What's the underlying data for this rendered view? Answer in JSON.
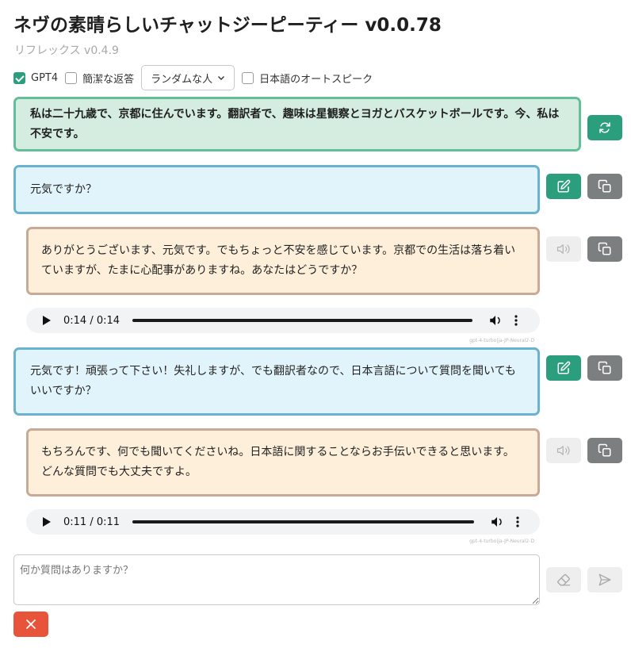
{
  "app": {
    "title": "ネヴの素晴らしいチャットジーピーティー v0.0.78",
    "subtitle": "リフレックス v0.4.9"
  },
  "options": {
    "gpt4": {
      "label": "GPT4",
      "checked": true
    },
    "concise": {
      "label": "簡潔な返答",
      "checked": false
    },
    "persona_select": {
      "value": "ランダムな人"
    },
    "autospeak": {
      "label": "日本語のオートスピーク",
      "checked": false
    }
  },
  "system_message": "私は二十九歳で、京都に住んでいます。翻訳者で、趣味は星観察とヨガとバスケットボールです。今、私は不安です。",
  "messages": [
    {
      "role": "user",
      "text": "元気ですか？"
    },
    {
      "role": "assistant",
      "text": "ありがとうございます、元気です。でもちょっと不安を感じています。京都での生活は落ち着いていますが、たまに心配事がありますね。あなたはどうですか？",
      "audio_time": "0:14 / 0:14",
      "voice": "gpt-4-turbo|ja-JP-Neural2-D"
    },
    {
      "role": "user",
      "text": "元気です！頑張って下さい！失礼しますが、でも翻訳者なので、日本言語について質問を聞いてもいいですか？"
    },
    {
      "role": "assistant",
      "text": "もちろんです、何でも聞いてくださいね。日本語に関することならお手伝いできると思います。どんな質問でも大丈夫ですよ。",
      "audio_time": "0:11 / 0:11",
      "voice": "gpt-4-turbo|ja-JP-Neural2-D"
    }
  ],
  "input": {
    "placeholder": "何か質問はありますか？",
    "value": ""
  },
  "icons": {
    "regenerate": "refresh-icon",
    "edit": "edit-icon",
    "copy": "copy-icon",
    "speak": "speaker-icon",
    "clear": "eraser-icon",
    "send": "send-icon",
    "stop": "close-icon"
  },
  "colors": {
    "accent": "#2b9e7e",
    "danger": "#e8543a",
    "copy_button": "#7c7f80",
    "user_bubble": "#e2f4fb",
    "assistant_bubble": "#fdefd9",
    "system_bubble": "#d5ede1"
  }
}
